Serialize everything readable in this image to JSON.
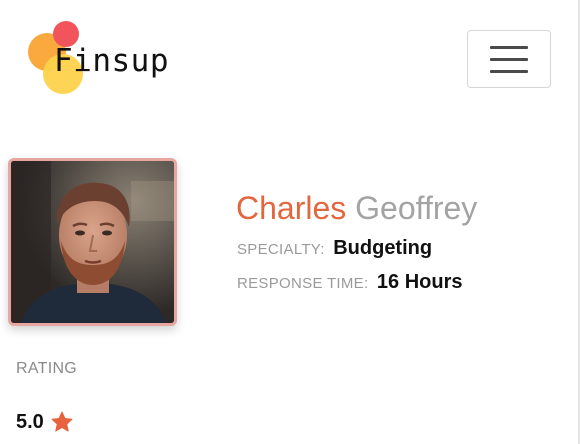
{
  "app": {
    "name": "Finsup"
  },
  "header": {
    "menu_icon": "hamburger-icon"
  },
  "profile": {
    "first_name": "Charles",
    "last_name": "Geoffrey",
    "specialty_label": "SPECIALTY:",
    "specialty_value": "Budgeting",
    "response_label": "RESPONSE TIME:",
    "response_value": "16 Hours"
  },
  "rating": {
    "label": "RATING",
    "value": "5.0",
    "icon": "star-icon"
  },
  "colors": {
    "accent_orange": "#e2673f",
    "logo_red": "#f0545a",
    "logo_orange": "#f8a83c",
    "logo_yellow": "#fcd146",
    "avatar_border": "#e8a6a0",
    "muted_text": "#a3a3a3",
    "star": "#e7633d"
  }
}
